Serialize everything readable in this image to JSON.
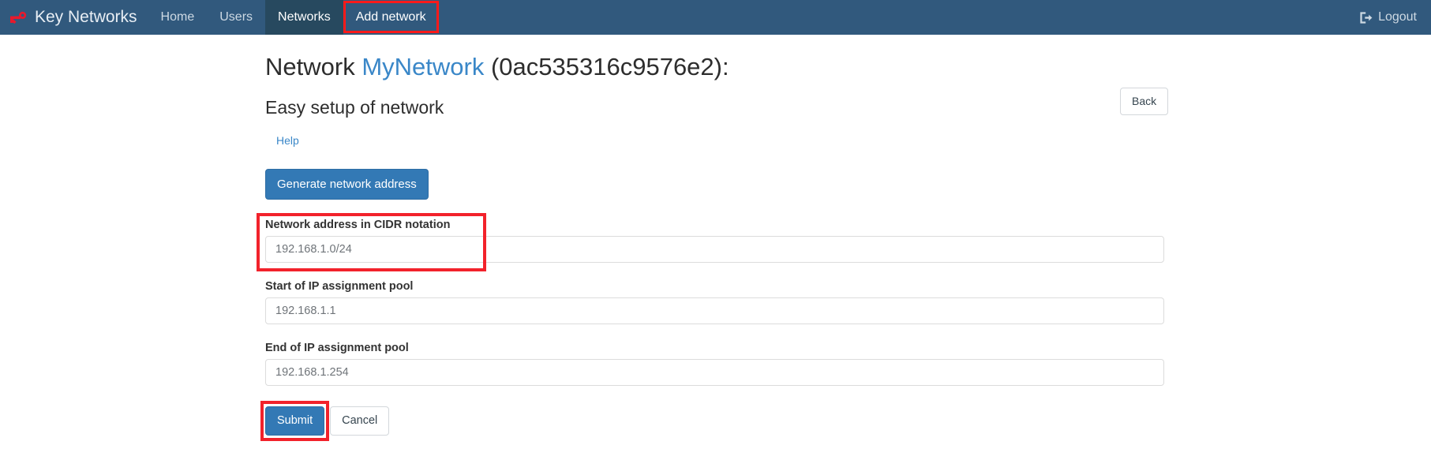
{
  "navbar": {
    "brand": {
      "label": "Key Networks",
      "icon": "key-icon"
    },
    "items": [
      {
        "label": "Home",
        "state": "normal"
      },
      {
        "label": "Users",
        "state": "normal"
      },
      {
        "label": "Networks",
        "state": "active"
      },
      {
        "label": "Add network",
        "state": "highlighted"
      }
    ],
    "logout": {
      "label": "Logout",
      "icon": "sign-out-icon"
    },
    "background_color": "#31597d",
    "active_background_color": "#27495f",
    "highlight_color": "#ff1a1a"
  },
  "header": {
    "title_prefix": "Network",
    "network_name": "MyNetwork",
    "title_suffix": "(0ac535316c9576e2):",
    "network_name_color": "#3a87c8",
    "back_label": "Back"
  },
  "main": {
    "subtitle": "Easy setup of network",
    "help_label": "Help",
    "generate_button_label": "Generate network address",
    "fields": [
      {
        "label": "Network address in CIDR notation",
        "value": "192.168.1.0/24",
        "placeholder": "Network address in CIDR notation",
        "name": "cidr"
      },
      {
        "label": "Start of IP assignment pool",
        "value": "192.168.1.1",
        "placeholder": "Start of IP assignment pool",
        "name": "pool-start"
      },
      {
        "label": "End of IP assignment pool",
        "value": "192.168.1.254",
        "placeholder": "End of IP assignment pool",
        "name": "pool-end"
      }
    ],
    "submit_label": "Submit",
    "cancel_label": "Cancel"
  },
  "theme": {
    "primary_button_color": "#3379b5",
    "link_color": "#3a87c8",
    "page_background": "#ffffff",
    "annotation_red": "#f2222b"
  }
}
